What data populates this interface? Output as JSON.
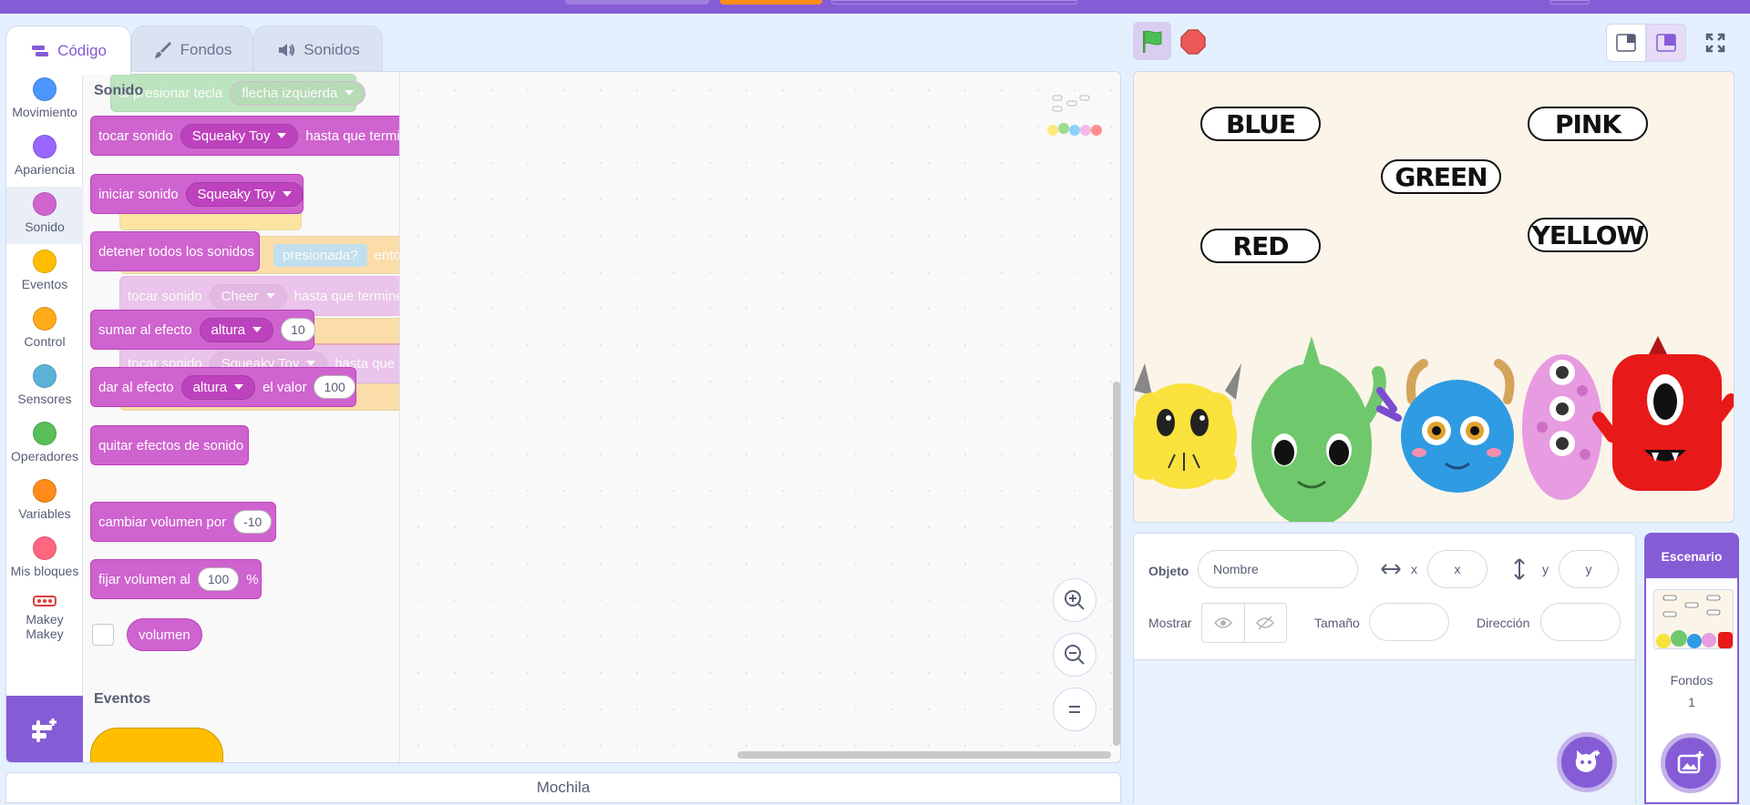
{
  "tabs": {
    "code": "Código",
    "costumes": "Fondos",
    "sounds": "Sonidos"
  },
  "categories": [
    {
      "label": "Movimiento",
      "color": "#4c97ff"
    },
    {
      "label": "Apariencia",
      "color": "#9966ff"
    },
    {
      "label": "Sonido",
      "color": "#cf63cf"
    },
    {
      "label": "Eventos",
      "color": "#ffbf00"
    },
    {
      "label": "Control",
      "color": "#ffab19"
    },
    {
      "label": "Sensores",
      "color": "#5cb1d6"
    },
    {
      "label": "Operadores",
      "color": "#59c059"
    },
    {
      "label": "Variables",
      "color": "#ff8c1a"
    },
    {
      "label": "Mis bloques",
      "color": "#ff6680"
    }
  ],
  "makey": {
    "line1": "Makey",
    "line2": "Makey"
  },
  "palette": {
    "sound_title": "Sonido",
    "events_title": "Eventos",
    "play_until_done": {
      "label": "tocar sonido",
      "sound": "Squeaky Toy",
      "suffix": "hasta que termine"
    },
    "start_sound": {
      "label": "iniciar sonido",
      "sound": "Squeaky Toy"
    },
    "stop_all": {
      "label": "detener todos los sonidos"
    },
    "change_effect": {
      "label": "sumar al efecto",
      "effect": "altura",
      "value": "10"
    },
    "set_effect": {
      "label": "dar al efecto",
      "effect": "altura",
      "mid": "el valor",
      "value": "100"
    },
    "clear_effects": {
      "label": "quitar efectos de sonido"
    },
    "change_volume": {
      "label": "cambiar volumen por",
      "value": "-10"
    },
    "set_volume": {
      "label": "fijar volumen al",
      "value": "100",
      "suffix": "%"
    },
    "volume_reporter": "volumen"
  },
  "ghost_script": {
    "key_hat": {
      "label": "al presionar tecla",
      "key": "flecha izquierda"
    },
    "touching": "presionada?",
    "then": "entonces",
    "play1": {
      "label": "tocar sonido",
      "sound": "Cheer",
      "suffix": "hasta que termine"
    },
    "play2": {
      "label": "tocar sonido",
      "sound": "Squeaky Toy",
      "suffix": "hasta que termine"
    }
  },
  "backpack": "Mochila",
  "stage_words": [
    "BLUE",
    "PINK",
    "GREEN",
    "RED",
    "YELLOW"
  ],
  "sprite_info": {
    "sprite_label": "Objeto",
    "name_placeholder": "Nombre",
    "x_label": "x",
    "x_placeholder": "x",
    "y_label": "y",
    "y_placeholder": "y",
    "show_label": "Mostrar",
    "size_label": "Tamaño",
    "direction_label": "Dirección"
  },
  "stage_panel": {
    "title": "Escenario",
    "backdrops_label": "Fondos",
    "backdrops_count": "1"
  },
  "colors": {
    "accent": "#855cd6",
    "sound": "#cf63cf",
    "events": "#ffbf00"
  }
}
